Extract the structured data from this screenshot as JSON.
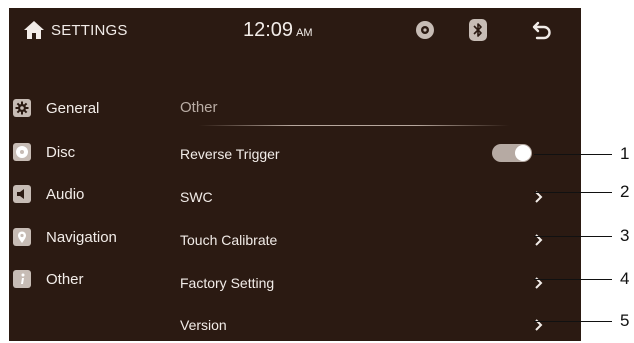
{
  "header": {
    "title": "SETTINGS",
    "time": "12:09",
    "ampm": "AM",
    "icons": [
      "home-icon",
      "disc-icon",
      "bluetooth-icon",
      "back-icon"
    ]
  },
  "sidebar": {
    "items": [
      {
        "label": "General",
        "icon": "gear-icon"
      },
      {
        "label": "Disc",
        "icon": "disc-icon"
      },
      {
        "label": "Audio",
        "icon": "speaker-icon"
      },
      {
        "label": "Navigation",
        "icon": "location-pin-icon"
      },
      {
        "label": "Other",
        "icon": "info-icon"
      }
    ]
  },
  "main": {
    "section_title": "Other",
    "rows": [
      {
        "label": "Reverse Trigger",
        "control": "toggle",
        "on": true
      },
      {
        "label": "SWC",
        "control": "chevron"
      },
      {
        "label": "Touch Calibrate",
        "control": "chevron"
      },
      {
        "label": "Factory Setting",
        "control": "chevron"
      },
      {
        "label": "Version",
        "control": "chevron"
      }
    ]
  },
  "callouts": [
    "1",
    "2",
    "3",
    "4",
    "5"
  ],
  "colors": {
    "screen_bg": "#2b1a12",
    "text": "#f2ece8",
    "muted_text": "#b9aca4",
    "icon_tile": "#c7bcb5",
    "toggle_track": "#b6aaa3"
  }
}
